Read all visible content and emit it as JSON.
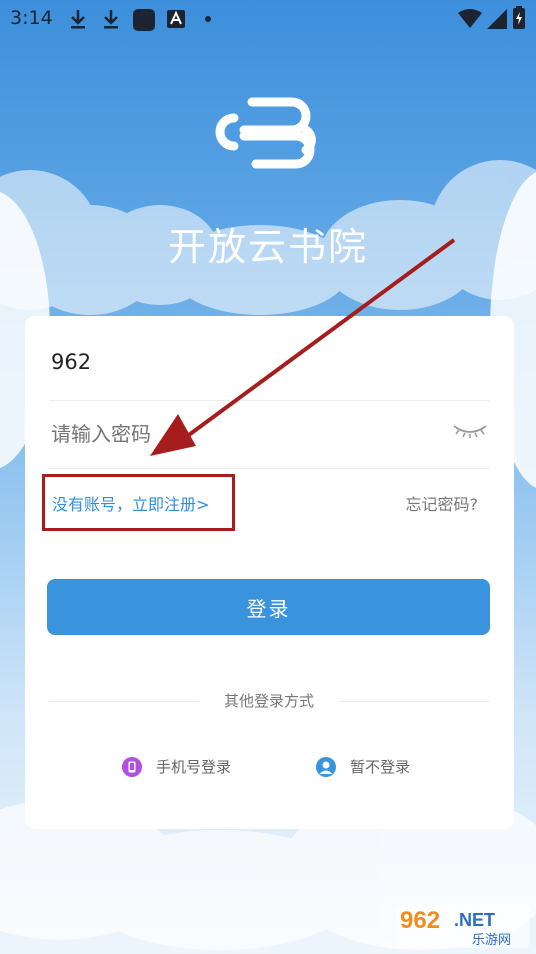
{
  "status_bar": {
    "time": "3:14"
  },
  "app": {
    "title": "开放云书院"
  },
  "login_form": {
    "username_value": "962",
    "password_placeholder": "请输入密码",
    "register_link": "没有账号，立即注册>",
    "forgot_password": "忘记密码?",
    "login_button": "登录",
    "other_methods_label": "其他登录方式",
    "alt_methods": [
      {
        "label": "手机号登录",
        "icon": "phone-icon",
        "color": "#b24fe0"
      },
      {
        "label": "暂不登录",
        "icon": "user-icon",
        "color": "#3a94dd"
      }
    ]
  },
  "annotation": {
    "highlight_color": "#a51d1d"
  },
  "watermark": {
    "site_text": "962.NET",
    "sub_text": "乐游网"
  }
}
